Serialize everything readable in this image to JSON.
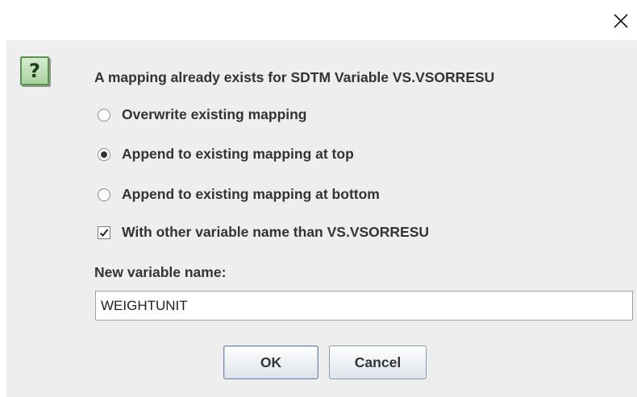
{
  "dialog": {
    "close_icon": "close-icon",
    "question_icon": "question-icon",
    "question_glyph": "?",
    "message": "A mapping already exists for SDTM Variable VS.VSORRESU",
    "options": [
      {
        "label": "Overwrite existing mapping",
        "type": "radio",
        "checked": false
      },
      {
        "label": "Append to existing mapping at top",
        "type": "radio",
        "checked": true
      },
      {
        "label": "Append to existing mapping at bottom",
        "type": "radio",
        "checked": false
      },
      {
        "label": "With other variable name than VS.VSORRESU",
        "type": "checkbox",
        "checked": true
      }
    ],
    "new_variable_label": "New variable name:",
    "new_variable_value": "WEIGHTUNIT",
    "ok_label": "OK",
    "cancel_label": "Cancel"
  },
  "colors": {
    "dialog_background": "#eeeeee",
    "text": "#333333",
    "question_icon_bg": "#a9d29f"
  }
}
